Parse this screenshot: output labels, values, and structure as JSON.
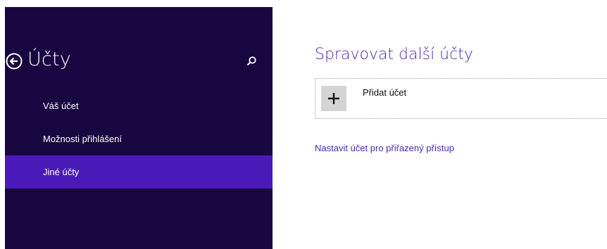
{
  "sidebar": {
    "title": "Účty",
    "back_icon": "back-arrow-circle-icon",
    "search_icon": "search-icon",
    "items": [
      {
        "label": "Váš účet",
        "selected": false
      },
      {
        "label": "Možnosti přihlášení",
        "selected": false
      },
      {
        "label": "Jiné účty",
        "selected": true
      }
    ]
  },
  "main": {
    "title": "Spravovat další účty",
    "add_account": {
      "label": "Přidat účet",
      "icon": "plus-icon"
    },
    "assigned_access_link": "Nastavit účet pro přiřazený přístup"
  },
  "colors": {
    "sidebar_bg": "#180640",
    "selected_bg": "#4a1ab8",
    "accent_text": "#4a2bb0",
    "tile_bg": "#d4d4d4"
  }
}
